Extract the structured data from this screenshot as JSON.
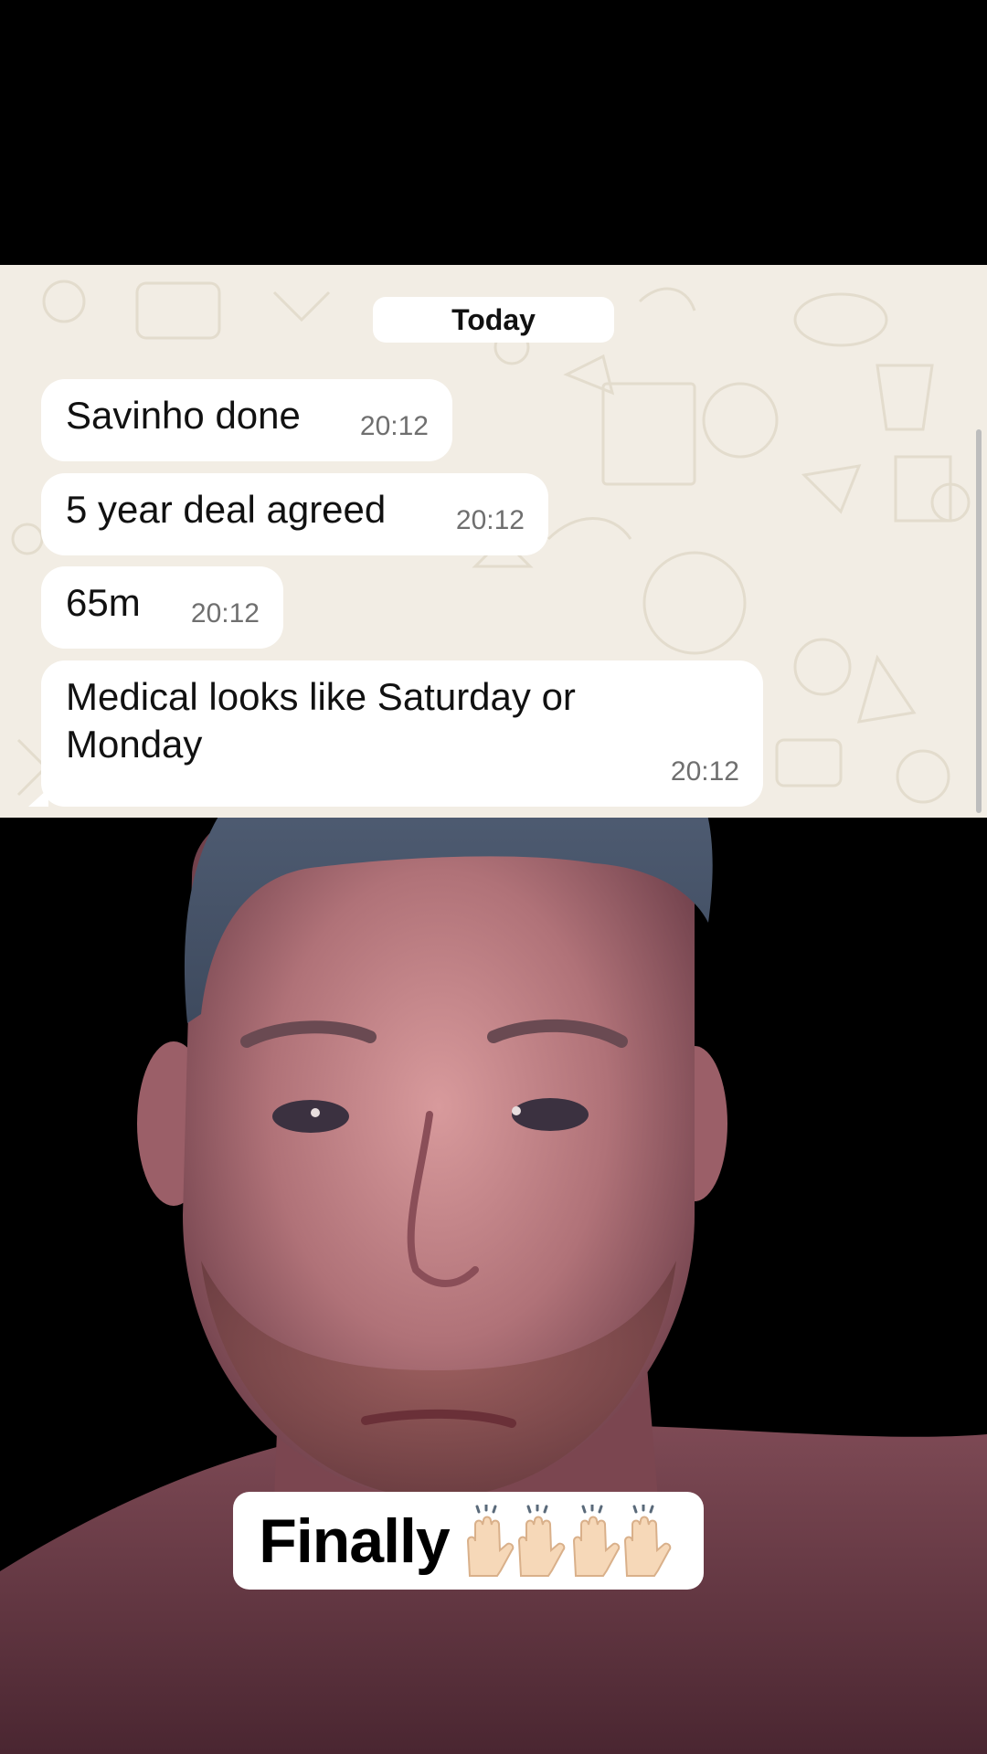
{
  "chat": {
    "date_label": "Today",
    "messages": [
      {
        "text": "Savinho done",
        "time": "20:12"
      },
      {
        "text": "5 year deal agreed",
        "time": "20:12"
      },
      {
        "text": "65m",
        "time": "20:12"
      },
      {
        "text_line1": "Medical looks like Saturday or",
        "text_line2": "Monday",
        "time": "20:12"
      }
    ]
  },
  "caption": {
    "text": "Finally",
    "emoji": "raised-hands-icon"
  },
  "colors": {
    "chat_background": "#f2ede4",
    "bubble": "#ffffff",
    "timestamp": "#6f6f6f",
    "letterbox": "#000000"
  }
}
